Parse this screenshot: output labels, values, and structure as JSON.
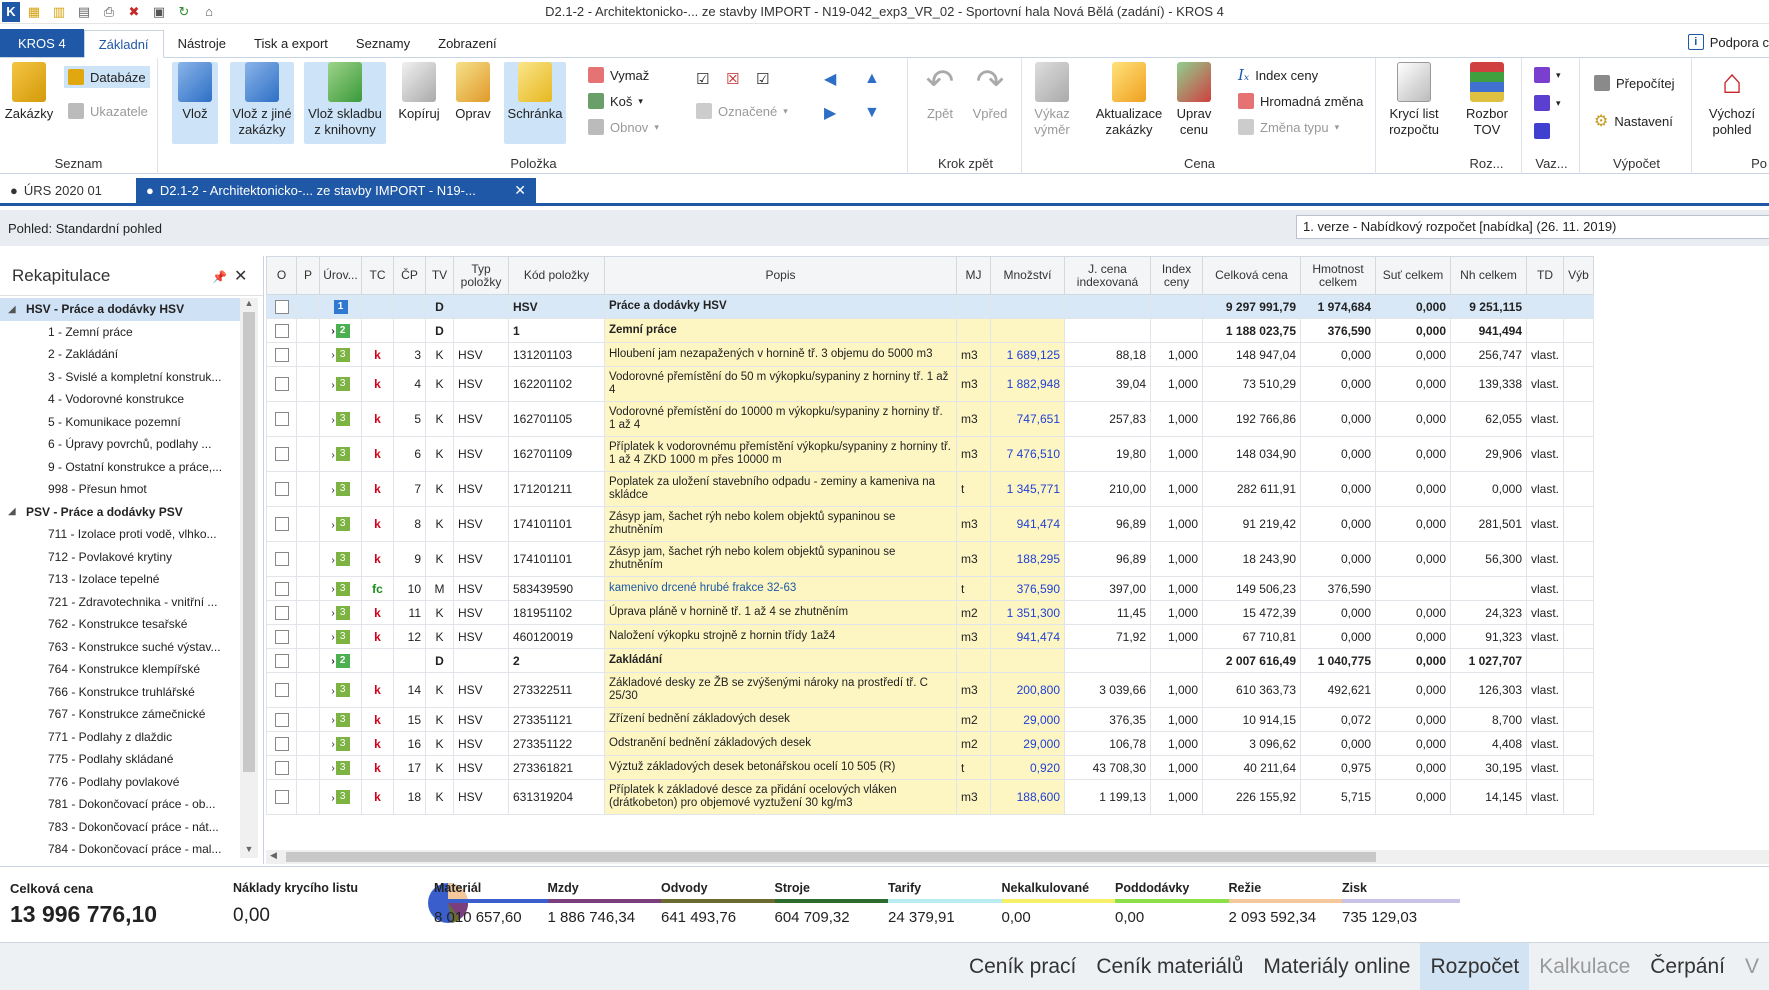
{
  "window": {
    "title": "D2.1-2 - Architektonicko-... ze stavby IMPORT - N19-042_exp3_VR_02 - Sportovní hala Nová Bělá (zadání) - KROS 4"
  },
  "ribbon_tabs": [
    "KROS 4",
    "Základní",
    "Nástroje",
    "Tisk a export",
    "Seznamy",
    "Zobrazení"
  ],
  "support_label": "Podpora c",
  "ribbon": {
    "seznam": {
      "label": "Seznam",
      "zakazky": "Zakázky",
      "databaze": "Databáze",
      "ukazatele": "Ukazatele"
    },
    "polozka": {
      "label": "Položka",
      "vloz": "Vlož",
      "vloz_jine": "Vlož z jiné zakázky",
      "vloz_skladbu": "Vlož skladbu z knihovny",
      "kopiruj": "Kopíruj",
      "oprav": "Oprav",
      "schranka": "Schránka",
      "vymaz": "Vymaž",
      "kos": "Koš",
      "obnov": "Obnov",
      "oznacene": "Označené"
    },
    "krok": {
      "label": "Krok zpět",
      "zpet": "Zpět",
      "vpred": "Vpřed"
    },
    "cena": {
      "label": "Cena",
      "vykaz": "Výkaz výměr",
      "aktualizace": "Aktualizace zakázky",
      "uprav": "Uprav cenu",
      "index": "Index ceny",
      "hromadna": "Hromadná změna",
      "zmena": "Změna typu"
    },
    "kryci": {
      "label": "Krycí list rozpočtu"
    },
    "roz": {
      "label": "Roz...",
      "rozbor": "Rozbor TOV"
    },
    "vaz": {
      "label": "Vaz..."
    },
    "vypocet": {
      "label": "Výpočet",
      "prepocitej": "Přepočítej",
      "nastaveni": "Nastavení"
    },
    "pohled": {
      "vychozi": "Výchozí pohled",
      "label": "Po"
    }
  },
  "doc_tabs": [
    "ÚRS 2020 01",
    "D2.1-2 - Architektonicko-... ze stavby IMPORT - N19-..."
  ],
  "view": {
    "label": "Pohled: Standardní pohled",
    "version": "1. verze - Nabídkový rozpočet [nabídka] (26. 11. 2019)"
  },
  "left_panel": {
    "title": "Rekapitulace",
    "items": [
      {
        "label": "HSV - Práce a dodávky HSV",
        "top": true
      },
      {
        "label": "1 - Zemní práce"
      },
      {
        "label": "2 - Zakládání"
      },
      {
        "label": "3 - Svislé a kompletní konstruk..."
      },
      {
        "label": "4 - Vodorovné konstrukce"
      },
      {
        "label": "5 - Komunikace pozemní"
      },
      {
        "label": "6 - Úpravy povrchů, podlahy ..."
      },
      {
        "label": "9 - Ostatní konstrukce a práce,..."
      },
      {
        "label": "998 - Přesun hmot"
      },
      {
        "label": "PSV - Práce a dodávky PSV",
        "top": true
      },
      {
        "label": "711 - Izolace proti vodě, vlhko..."
      },
      {
        "label": "712 - Povlakové krytiny"
      },
      {
        "label": "713 - Izolace tepelné"
      },
      {
        "label": "721 - Zdravotechnika - vnitřní ..."
      },
      {
        "label": "762 - Konstrukce tesařské"
      },
      {
        "label": "763 - Konstrukce suché výstav..."
      },
      {
        "label": "764 - Konstrukce klempířské"
      },
      {
        "label": "766 - Konstrukce truhlářské"
      },
      {
        "label": "767 - Konstrukce zámečnické"
      },
      {
        "label": "771 - Podlahy z dlaždic"
      },
      {
        "label": "775 - Podlahy skládané"
      },
      {
        "label": "776 - Podlahy povlakové"
      },
      {
        "label": "781 - Dokončovací práce - ob..."
      },
      {
        "label": "783 - Dokončovací práce - nát..."
      },
      {
        "label": "784 - Dokončovací práce - mal..."
      }
    ]
  },
  "table": {
    "headers": [
      "O",
      "P",
      "Úrov...",
      "TC",
      "ČP",
      "TV",
      "Typ položky",
      "Kód položky",
      "Popis",
      "MJ",
      "Množství",
      "J. cena indexovaná",
      "Index ceny",
      "Celková cena",
      "Hmotnost celkem",
      "Suť celkem",
      "Nh celkem",
      "TD",
      "Výb"
    ],
    "rows": [
      {
        "kind": "hsv",
        "lvl": "1",
        "tv": "D",
        "typ": "",
        "kod": "HSV",
        "popis": "Práce a dodávky HSV",
        "mj": "",
        "mn": "",
        "jc": "",
        "ic": "",
        "cc": "9 297 991,79",
        "hm": "1 974,684",
        "sut": "0,000",
        "nh": "9 251,115",
        "td": ""
      },
      {
        "kind": "sec",
        "lvl": "2",
        "tv": "D",
        "typ": "",
        "kod": "1",
        "popis": "Zemní práce",
        "mj": "",
        "mn": "",
        "jc": "",
        "ic": "",
        "cc": "1 188 023,75",
        "hm": "376,590",
        "sut": "0,000",
        "nh": "941,494",
        "td": ""
      },
      {
        "lvl": "3",
        "tc": "k",
        "cp": "3",
        "tv": "K",
        "typ": "HSV",
        "kod": "131201103",
        "popis": "Hloubení jam nezapažených v hornině tř. 3 objemu do 5000 m3",
        "mj": "m3",
        "mn": "1 689,125",
        "jc": "88,18",
        "ic": "1,000",
        "cc": "148 947,04",
        "hm": "0,000",
        "sut": "0,000",
        "nh": "256,747",
        "td": "vlast."
      },
      {
        "lvl": "3",
        "tc": "k",
        "cp": "4",
        "tv": "K",
        "typ": "HSV",
        "kod": "162201102",
        "popis": "Vodorovné přemístění do 50 m výkopku/sypaniny z horniny tř. 1 až 4",
        "mj": "m3",
        "mn": "1 882,948",
        "jc": "39,04",
        "ic": "1,000",
        "cc": "73 510,29",
        "hm": "0,000",
        "sut": "0,000",
        "nh": "139,338",
        "td": "vlast.",
        "tall": true
      },
      {
        "lvl": "3",
        "tc": "k",
        "cp": "5",
        "tv": "K",
        "typ": "HSV",
        "kod": "162701105",
        "popis": "Vodorovné přemístění do 10000 m výkopku/sypaniny z horniny tř. 1 až 4",
        "mj": "m3",
        "mn": "747,651",
        "jc": "257,83",
        "ic": "1,000",
        "cc": "192 766,86",
        "hm": "0,000",
        "sut": "0,000",
        "nh": "62,055",
        "td": "vlast.",
        "tall": true
      },
      {
        "lvl": "3",
        "tc": "k",
        "cp": "6",
        "tv": "K",
        "typ": "HSV",
        "kod": "162701109",
        "popis": "Příplatek k vodorovnému přemístění výkopku/sypaniny z horniny tř. 1 až 4 ZKD 1000 m přes 10000 m",
        "mj": "m3",
        "mn": "7 476,510",
        "jc": "19,80",
        "ic": "1,000",
        "cc": "148 034,90",
        "hm": "0,000",
        "sut": "0,000",
        "nh": "29,906",
        "td": "vlast.",
        "tall": true
      },
      {
        "lvl": "3",
        "tc": "k",
        "cp": "7",
        "tv": "K",
        "typ": "HSV",
        "kod": "171201211",
        "popis": "Poplatek za uložení stavebního odpadu - zeminy a kameniva na skládce",
        "mj": "t",
        "mn": "1 345,771",
        "jc": "210,00",
        "ic": "1,000",
        "cc": "282 611,91",
        "hm": "0,000",
        "sut": "0,000",
        "nh": "0,000",
        "td": "vlast.",
        "tall": true
      },
      {
        "lvl": "3",
        "tc": "k",
        "cp": "8",
        "tv": "K",
        "typ": "HSV",
        "kod": "174101101",
        "popis": "Zásyp jam, šachet rýh nebo kolem objektů sypaninou se zhutněním",
        "mj": "m3",
        "mn": "941,474",
        "jc": "96,89",
        "ic": "1,000",
        "cc": "91 219,42",
        "hm": "0,000",
        "sut": "0,000",
        "nh": "281,501",
        "td": "vlast.",
        "tall": true
      },
      {
        "lvl": "3",
        "tc": "k",
        "cp": "9",
        "tv": "K",
        "typ": "HSV",
        "kod": "174101101",
        "popis": "Zásyp jam, šachet rýh nebo kolem objektů sypaninou se zhutněním",
        "mj": "m3",
        "mn": "188,295",
        "jc": "96,89",
        "ic": "1,000",
        "cc": "18 243,90",
        "hm": "0,000",
        "sut": "0,000",
        "nh": "56,300",
        "td": "vlast.",
        "tall": true
      },
      {
        "lvl": "3",
        "tc": "fc",
        "cp": "10",
        "tv": "M",
        "typ": "HSV",
        "kod": "583439590",
        "popis": "kamenivo drcené hrubé frakce 32-63",
        "mj": "t",
        "mn": "376,590",
        "jc": "397,00",
        "ic": "1,000",
        "cc": "149 506,23",
        "hm": "376,590",
        "sut": "",
        "nh": "",
        "td": "vlast.",
        "blue": true
      },
      {
        "lvl": "3",
        "tc": "k",
        "cp": "11",
        "tv": "K",
        "typ": "HSV",
        "kod": "181951102",
        "popis": "Úprava pláně v hornině tř. 1 až 4 se zhutněním",
        "mj": "m2",
        "mn": "1 351,300",
        "jc": "11,45",
        "ic": "1,000",
        "cc": "15 472,39",
        "hm": "0,000",
        "sut": "0,000",
        "nh": "24,323",
        "td": "vlast."
      },
      {
        "lvl": "3",
        "tc": "k",
        "cp": "12",
        "tv": "K",
        "typ": "HSV",
        "kod": "460120019",
        "popis": "Naložení výkopku strojně z hornin třídy 1až4",
        "mj": "m3",
        "mn": "941,474",
        "jc": "71,92",
        "ic": "1,000",
        "cc": "67 710,81",
        "hm": "0,000",
        "sut": "0,000",
        "nh": "91,323",
        "td": "vlast."
      },
      {
        "kind": "sec",
        "lvl": "2",
        "tv": "D",
        "typ": "",
        "kod": "2",
        "popis": "Zakládání",
        "mj": "",
        "mn": "",
        "jc": "",
        "ic": "",
        "cc": "2 007 616,49",
        "hm": "1 040,775",
        "sut": "0,000",
        "nh": "1 027,707",
        "td": ""
      },
      {
        "lvl": "3",
        "tc": "k",
        "cp": "14",
        "tv": "K",
        "typ": "HSV",
        "kod": "273322511",
        "popis": "Základové desky ze ŽB se zvýšenými nároky na prostředí tř. C 25/30",
        "mj": "m3",
        "mn": "200,800",
        "jc": "3 039,66",
        "ic": "1,000",
        "cc": "610 363,73",
        "hm": "492,621",
        "sut": "0,000",
        "nh": "126,303",
        "td": "vlast.",
        "tall": true
      },
      {
        "lvl": "3",
        "tc": "k",
        "cp": "15",
        "tv": "K",
        "typ": "HSV",
        "kod": "273351121",
        "popis": "Zřízení bednění základových desek",
        "mj": "m2",
        "mn": "29,000",
        "jc": "376,35",
        "ic": "1,000",
        "cc": "10 914,15",
        "hm": "0,072",
        "sut": "0,000",
        "nh": "8,700",
        "td": "vlast."
      },
      {
        "lvl": "3",
        "tc": "k",
        "cp": "16",
        "tv": "K",
        "typ": "HSV",
        "kod": "273351122",
        "popis": "Odstranění bednění základových desek",
        "mj": "m2",
        "mn": "29,000",
        "jc": "106,78",
        "ic": "1,000",
        "cc": "3 096,62",
        "hm": "0,000",
        "sut": "0,000",
        "nh": "4,408",
        "td": "vlast."
      },
      {
        "lvl": "3",
        "tc": "k",
        "cp": "17",
        "tv": "K",
        "typ": "HSV",
        "kod": "273361821",
        "popis": "Výztuž základových desek betonářskou ocelí 10 505 (R)",
        "mj": "t",
        "mn": "0,920",
        "jc": "43 708,30",
        "ic": "1,000",
        "cc": "40 211,64",
        "hm": "0,975",
        "sut": "0,000",
        "nh": "30,195",
        "td": "vlast."
      },
      {
        "lvl": "3",
        "tc": "k",
        "cp": "18",
        "tv": "K",
        "typ": "HSV",
        "kod": "631319204",
        "popis": "Příplatek k základové desce za přidání ocelových vláken (drátkobeton) pro objemové vyztužení 30 kg/m3",
        "mj": "m3",
        "mn": "188,600",
        "jc": "1 199,13",
        "ic": "1,000",
        "cc": "226 155,92",
        "hm": "5,715",
        "sut": "0,000",
        "nh": "14,145",
        "td": "vlast.",
        "tall": true
      }
    ]
  },
  "summary": {
    "total_label": "Celková cena",
    "total_value": "13 996 776,10",
    "kryci_label": "Náklady krycího listu",
    "kryci_value": "0,00",
    "categories": [
      {
        "name": "Materiál",
        "value": "8 010 657,60",
        "color": "#3a5fcd"
      },
      {
        "name": "Mzdy",
        "value": "1 886 746,34",
        "color": "#7b3f7d"
      },
      {
        "name": "Odvody",
        "value": "641 493,76",
        "color": "#6b6b2f"
      },
      {
        "name": "Stroje",
        "value": "604 709,32",
        "color": "#2e6b2e"
      },
      {
        "name": "Tarify",
        "value": "24 379,91",
        "color": "#b8ecf0"
      },
      {
        "name": "Nekalkulované",
        "value": "0,00",
        "color": "#f5ef6a"
      },
      {
        "name": "Poddodávky",
        "value": "0,00",
        "color": "#8be04a"
      },
      {
        "name": "Režie",
        "value": "2 093 592,34",
        "color": "#f5c89c"
      },
      {
        "name": "Zisk",
        "value": "735 129,03",
        "color": "#c9c3ea"
      }
    ]
  },
  "bottom_nav": [
    "Ceník prací",
    "Ceník materiálů",
    "Materiály online",
    "Rozpočet",
    "Kalkulace",
    "Čerpání",
    "V"
  ]
}
